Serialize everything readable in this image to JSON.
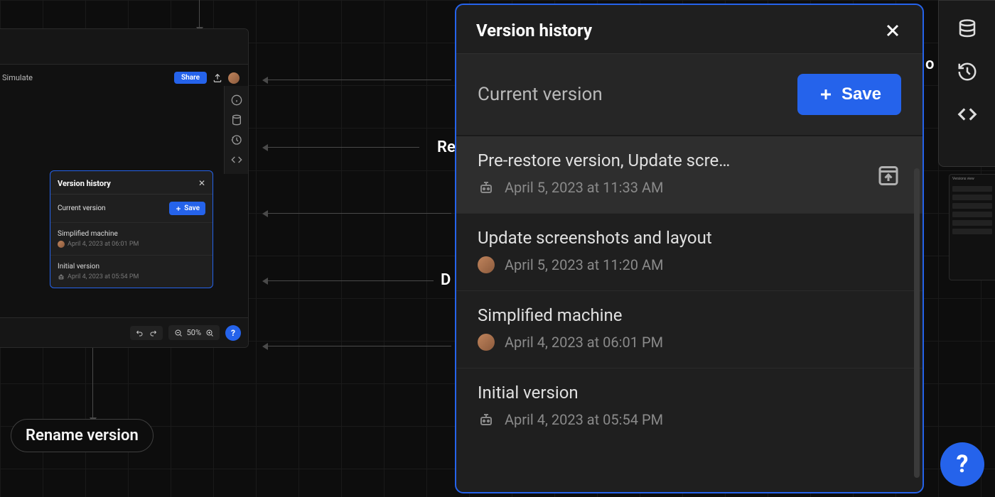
{
  "main_modal": {
    "title": "Version history",
    "current_label": "Current version",
    "save_label": "Save",
    "items": [
      {
        "title": "Pre-restore version, Update scre…",
        "date": "April 5, 2023 at 11:33 AM",
        "author_type": "bot",
        "highlighted": true,
        "restorable": true
      },
      {
        "title": "Update screenshots and layout",
        "date": "April 5, 2023 at 11:20 AM",
        "author_type": "user"
      },
      {
        "title": "Simplified machine",
        "date": "April 4, 2023 at 06:01 PM",
        "author_type": "user"
      },
      {
        "title": "Initial version",
        "date": "April 4, 2023 at 05:54 PM",
        "author_type": "bot"
      }
    ]
  },
  "mini_modal": {
    "title": "Version history",
    "current_label": "Current version",
    "save_label": "Save",
    "items": [
      {
        "title": "Simplified machine",
        "date": "April 4, 2023 at 06:01 PM",
        "author_type": "user"
      },
      {
        "title": "Initial version",
        "date": "April 4, 2023 at 05:54 PM",
        "author_type": "bot"
      }
    ]
  },
  "left_panel": {
    "tab_label": "Simulate",
    "share_label": "Share",
    "zoom": "50%"
  },
  "bg_nodes": {
    "rename": "Rename version",
    "re_partial": "Re",
    "d_partial": "D",
    "o_partial": "o"
  },
  "help_label": "?",
  "tiny_right": {
    "title": "Versions view"
  }
}
